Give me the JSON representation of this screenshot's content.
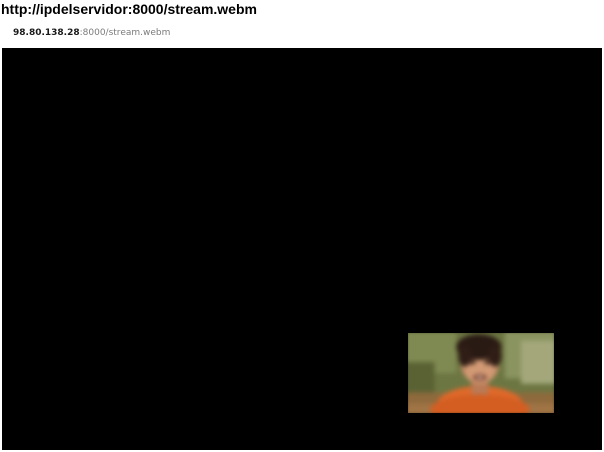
{
  "page": {
    "heading": "http://ipdelservidor:8000/stream.webm"
  },
  "address_bar": {
    "host": "98.80.138.28",
    "path": ":8000/stream.webm"
  },
  "video": {
    "background_color": "#000000",
    "frame_description_icon": "video-frame-thumbnail"
  },
  "colors": {
    "video_bg": "#000000",
    "frame_olive": "#6f7b44",
    "frame_orange": "#e0692a"
  }
}
